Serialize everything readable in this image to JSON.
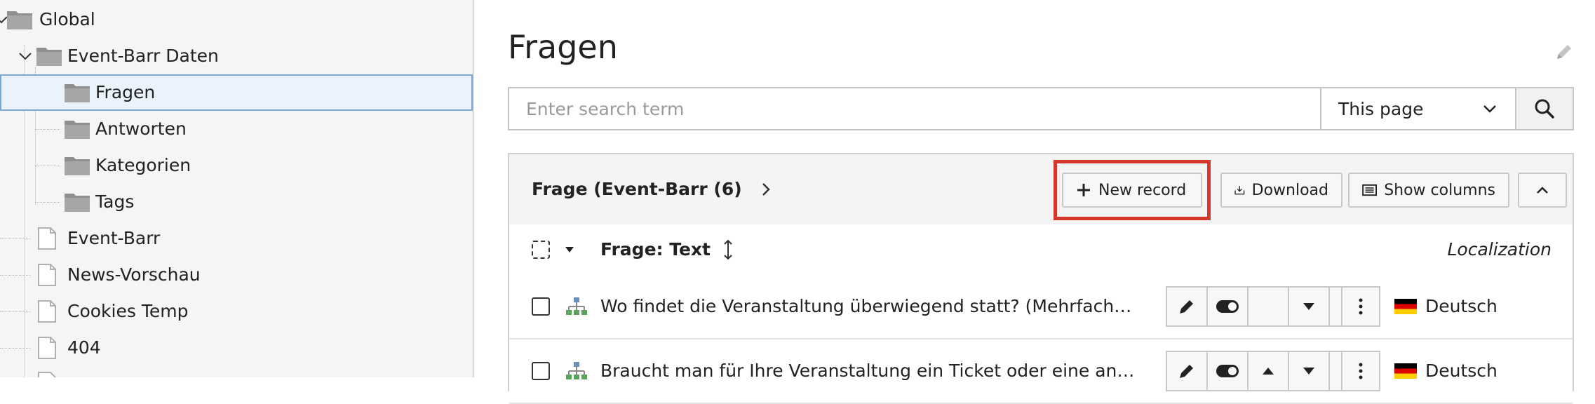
{
  "tree": {
    "items": [
      {
        "label": "Global",
        "type": "folder",
        "expanded": true
      },
      {
        "label": "Event-Barr Daten",
        "type": "folder",
        "expanded": true
      },
      {
        "label": "Fragen",
        "type": "folder",
        "selected": true
      },
      {
        "label": "Antworten",
        "type": "folder"
      },
      {
        "label": "Kategorien",
        "type": "folder"
      },
      {
        "label": "Tags",
        "type": "folder"
      },
      {
        "label": "Event-Barr",
        "type": "page"
      },
      {
        "label": "News-Vorschau",
        "type": "page"
      },
      {
        "label": "Cookies Temp",
        "type": "page"
      },
      {
        "label": "404",
        "type": "page"
      }
    ]
  },
  "main": {
    "title": "Fragen",
    "search": {
      "placeholder": "Enter search term",
      "scope": "This page"
    },
    "panel": {
      "title": "Frage (Event-Barr (6)",
      "buttons": {
        "new_record": "New record",
        "download": "Download",
        "show_columns": "Show columns"
      },
      "column_title": "Frage: Text",
      "localization_header": "Localization",
      "rows": [
        {
          "text": "Wo findet die Veranstaltung überwiegend statt? (Mehrfachnennungen möglich)",
          "language": "Deutsch"
        },
        {
          "text": "Braucht man für Ihre Veranstaltung ein Ticket oder eine andere Anmeldung?",
          "language": "Deutsch"
        }
      ]
    }
  },
  "colors": {
    "highlight": "#d6362b",
    "selection_border": "#7aa7d7",
    "selection_bg": "#eaf2fb"
  },
  "icons": [
    "folder-icon",
    "page-icon",
    "chevron-down-icon",
    "chevron-right-icon",
    "pencil-icon",
    "search-icon",
    "plus-icon",
    "download-icon",
    "columns-icon",
    "chevron-up-icon",
    "checkbox-icon",
    "sort-icon",
    "tree-icon",
    "toggle-icon",
    "arrow-down-icon",
    "arrow-up-icon",
    "trash-icon",
    "more-icon",
    "flag-de-icon"
  ]
}
